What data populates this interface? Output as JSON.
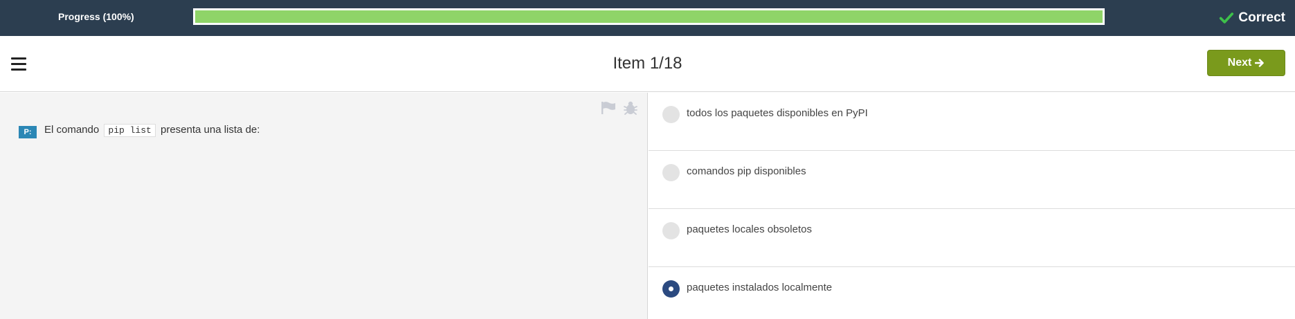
{
  "topbar": {
    "progress_label": "Progress (100%)",
    "progress_fraction": 1.0,
    "status_text": "Correct",
    "status_icon": "check-icon",
    "colors": {
      "bar_bg": "#2c3e50",
      "progress_fill": "#8fd468",
      "check": "#3ec04a"
    }
  },
  "header": {
    "menu_icon": "hamburger-menu-icon",
    "item_title": "Item 1/18",
    "next_label": "Next",
    "next_icon": "arrow-right-icon",
    "colors": {
      "next_button": "#7a9a1c"
    }
  },
  "question": {
    "badge": "P:",
    "text_before": "El comando",
    "code": "pip list",
    "text_after": "presenta una lista de:",
    "flag_icon": "flag-icon",
    "bug_icon": "bug-icon"
  },
  "options": [
    {
      "label": "todos los paquetes disponibles en PyPI",
      "selected": false
    },
    {
      "label": "comandos pip disponibles",
      "selected": false
    },
    {
      "label": "paquetes locales obsoletos",
      "selected": false
    },
    {
      "label": "paquetes instalados localmente",
      "selected": true
    }
  ],
  "colors": {
    "selected_radio": "#2b4a80"
  }
}
